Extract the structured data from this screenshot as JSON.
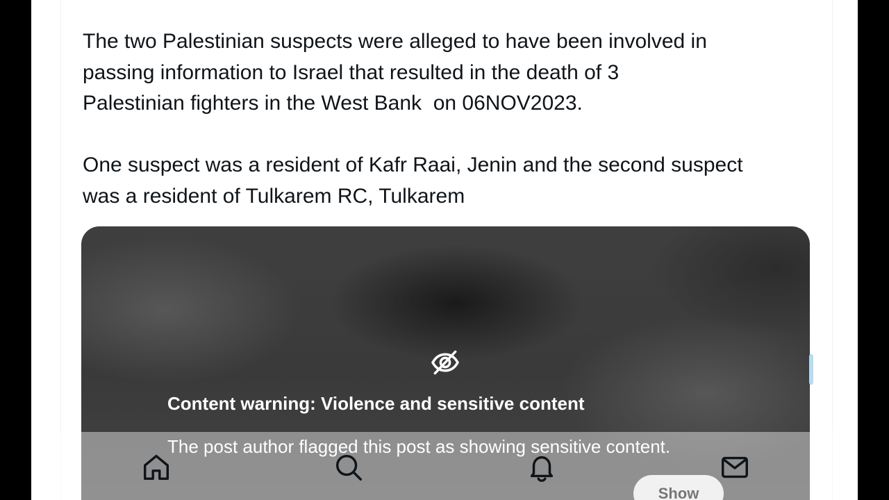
{
  "post": {
    "paragraph_1": "The two Palestinian suspects were alleged to have been involved in\npassing information to Israel that resulted in the death of 3\nPalestinian fighters in the West Bank  on 06NOV2023.",
    "paragraph_2": "One suspect was a resident of Kafr Raai, Jenin and the second suspect\nwas a resident of Tulkarem RC, Tulkarem"
  },
  "media_warning": {
    "icon": "eye-slash-icon",
    "title": "Content warning: Violence and sensitive content",
    "description": "The post author flagged this post as showing sensitive content.",
    "show_label": "Show"
  },
  "bottom_nav": {
    "items": [
      {
        "icon": "home-icon"
      },
      {
        "icon": "search-icon"
      },
      {
        "icon": "bell-icon"
      },
      {
        "icon": "mail-icon"
      }
    ]
  },
  "colors": {
    "text": "#0f1419",
    "background": "#ffffff",
    "overlay_text": "#ffffff",
    "show_button": "#e7e7e7",
    "outer_background": "#000000"
  }
}
